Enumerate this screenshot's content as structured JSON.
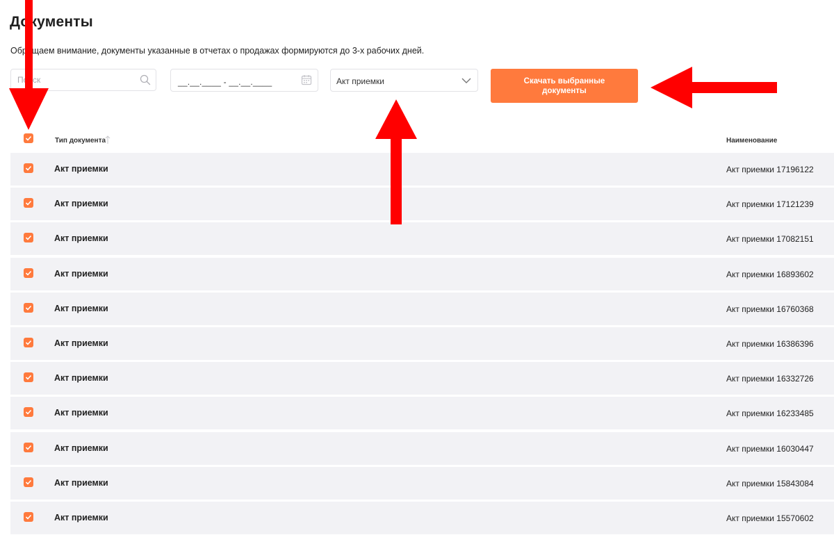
{
  "page": {
    "title": "Документы",
    "notice": "Обращаем внимание, документы указанные в отчетах о продажах формируются до 3-х рабочих дней."
  },
  "filters": {
    "search_placeholder": "Поиск",
    "search_icon": "search-icon",
    "date_range_value": "__.__.____ - __.__.____",
    "date_icon": "calendar-icon",
    "doc_type_selected": "Акт приемки",
    "doc_type_icon": "chevron-down-icon",
    "download_label": "Скачать выбранные документы"
  },
  "table": {
    "select_all_checked": true,
    "columns": {
      "type": "Тип документа",
      "name": "Наименование"
    },
    "rows": [
      {
        "type": "Акт приемки",
        "name": "Акт приемки 17196122",
        "checked": true
      },
      {
        "type": "Акт приемки",
        "name": "Акт приемки 17121239",
        "checked": true
      },
      {
        "type": "Акт приемки",
        "name": "Акт приемки 17082151",
        "checked": true
      },
      {
        "type": "Акт приемки",
        "name": "Акт приемки 16893602",
        "checked": true
      },
      {
        "type": "Акт приемки",
        "name": "Акт приемки 16760368",
        "checked": true
      },
      {
        "type": "Акт приемки",
        "name": "Акт приемки 16386396",
        "checked": true
      },
      {
        "type": "Акт приемки",
        "name": "Акт приемки 16332726",
        "checked": true
      },
      {
        "type": "Акт приемки",
        "name": "Акт приемки 16233485",
        "checked": true
      },
      {
        "type": "Акт приемки",
        "name": "Акт приемки 16030447",
        "checked": true
      },
      {
        "type": "Акт приемки",
        "name": "Акт приемки 15843084",
        "checked": true
      },
      {
        "type": "Акт приемки",
        "name": "Акт приемки 15570602",
        "checked": true
      }
    ]
  },
  "colors": {
    "accent": "#ff7a3d",
    "row_bg": "#f2f2f5",
    "annotation_arrow": "#ff0000"
  }
}
